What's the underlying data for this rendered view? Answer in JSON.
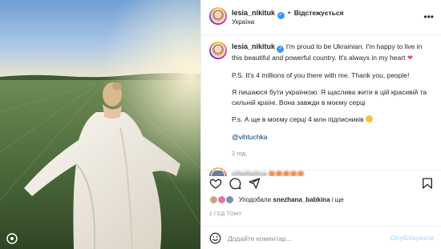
{
  "post": {
    "username": "lesia_nikituk",
    "follow_label": "Відстежується",
    "location": "Україна",
    "caption": {
      "username": "lesia_nikituk",
      "line1": "I'm proud to be Ukrainian. I'm happy to live in this beautiful and powerful country. It's always in my heart",
      "line2": "P.S. It's 4 millions of you there with me. Thank you, people!",
      "line3": "Я пишаюся бути українкою. Я щаслива жити в цій красивій та сильній країні. Вона завжди в моєму серці",
      "line4": "P.s. А ще в моєму серці 4 млн підписників",
      "mention": "@vihtuchka",
      "time": "2 год."
    },
    "likes": {
      "prefix": "Уподобали",
      "user": "snezhana_babkina",
      "suffix": "і ще"
    },
    "time_ago": "2 ГОД ТОМУ",
    "comment_placeholder": "Додайте коментар...",
    "publish_label": "Опублікувати"
  },
  "icons": {
    "more": "more-horizontal-icon",
    "like": "heart-outline-icon",
    "comment": "speech-bubble-icon",
    "share": "paper-plane-icon",
    "save": "bookmark-icon",
    "emoji": "smile-icon",
    "verified": "verified-badge-icon",
    "carousel": "carousel-icon"
  },
  "colors": {
    "link": "#00376b",
    "verified": "#3897f0",
    "heart": "#ed4956",
    "publish_disabled": "#b2dffc",
    "meta": "#8e8e8e"
  }
}
